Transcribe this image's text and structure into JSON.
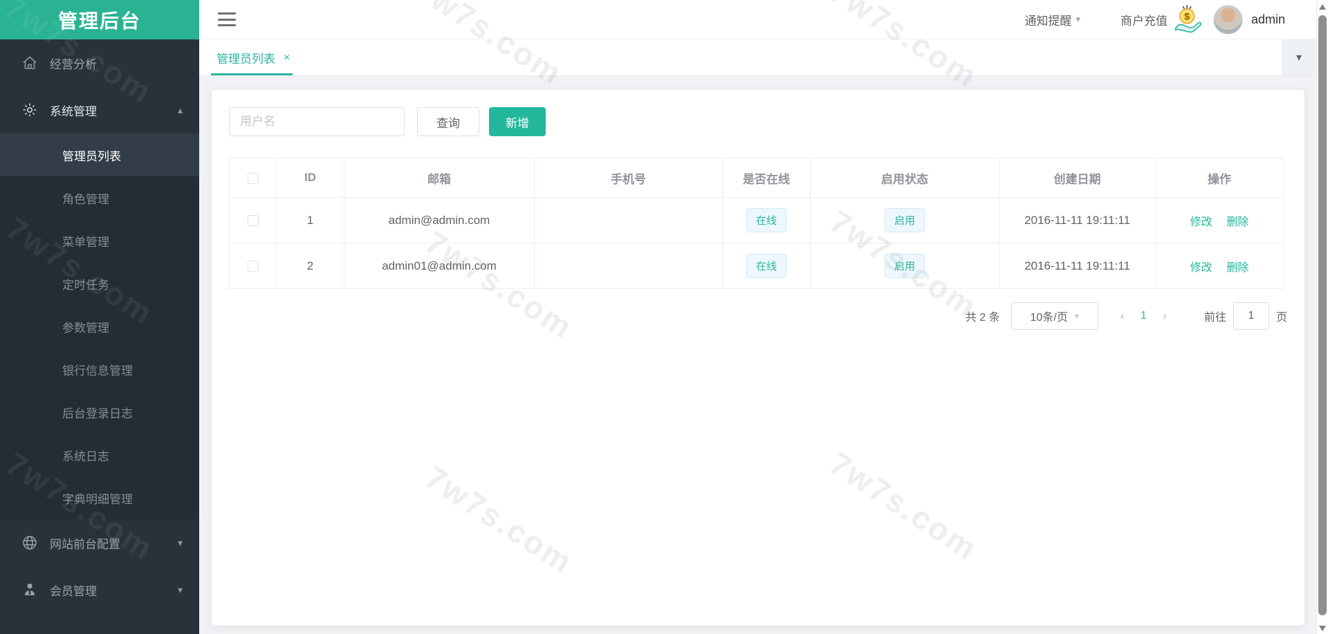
{
  "app": {
    "title": "管理后台"
  },
  "watermark": {
    "text": "7w7s.com"
  },
  "colors": {
    "brand_teal": "#2ab393",
    "button_teal": "#23b79c",
    "tab_teal": "#2cb5a0",
    "sidebar_bg": "#29323b",
    "submenu_bg": "#242d35",
    "active_item_bg": "#323d47",
    "badge_bg": "#edf7fd",
    "badge_border": "#d0e9f7",
    "badge_text": "#27b79b",
    "page_bg": "#f0f2f5"
  },
  "sidebar": {
    "logo": "管理后台",
    "item_analysis": "经营分析",
    "item_system": "系统管理",
    "submenu": [
      "管理员列表",
      "角色管理",
      "菜单管理",
      "定时任务",
      "参数管理",
      "银行信息管理",
      "后台登录日志",
      "系统日志",
      "字典明细管理"
    ],
    "item_frontend": "网站前台配置",
    "item_member": "会员管理"
  },
  "header": {
    "notify": "通知提醒",
    "recharge": "商户充值",
    "username": "admin"
  },
  "tabs": {
    "current": "管理员列表",
    "close": "×"
  },
  "toolbar": {
    "username_placeholder": "用户名",
    "search_label": "查询",
    "add_label": "新增"
  },
  "table": {
    "columns": [
      "ID",
      "邮箱",
      "手机号",
      "是否在线",
      "启用状态",
      "创建日期",
      "操作"
    ],
    "rows": [
      {
        "id": "1",
        "email": "admin@admin.com",
        "phone": "",
        "online": "在线",
        "status": "启用",
        "created": "2016-11-11 19:11:11"
      },
      {
        "id": "2",
        "email": "admin01@admin.com",
        "phone": "",
        "online": "在线",
        "status": "启用",
        "created": "2016-11-11 19:11:11"
      }
    ],
    "actions": {
      "edit": "修改",
      "delete": "删除"
    }
  },
  "pagination": {
    "total": "共 2 条",
    "page_size": "10条/页",
    "current": "1",
    "goto_label": "前往",
    "goto_value": "1",
    "page_unit": "页"
  }
}
